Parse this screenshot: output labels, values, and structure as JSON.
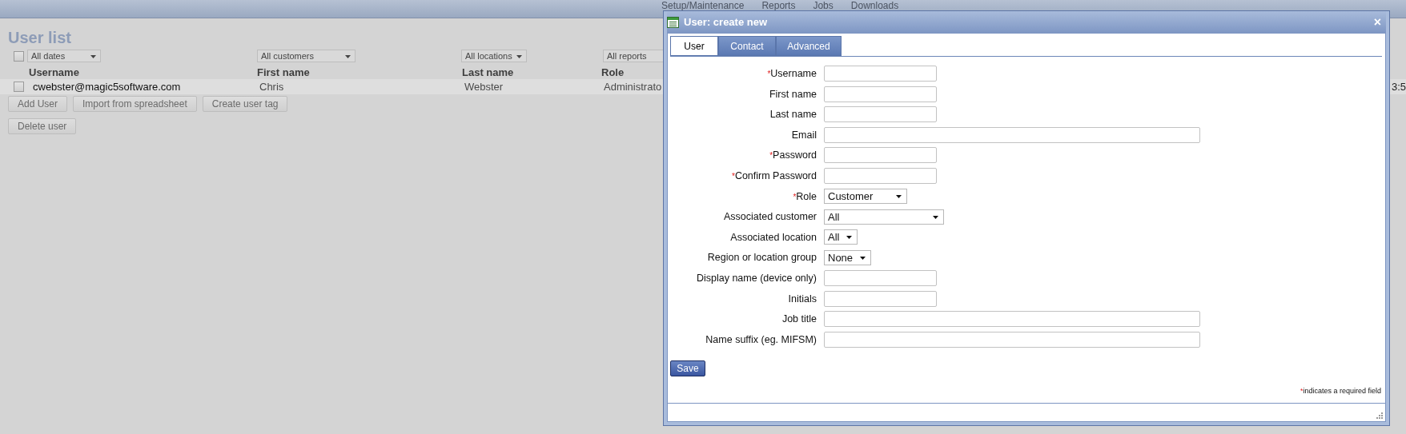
{
  "nav": [
    "Setup/Maintenance",
    "Reports",
    "Jobs",
    "Downloads"
  ],
  "page": {
    "title": "User list",
    "select_all": {
      "checked": false
    },
    "filters": [
      {
        "label": "All dates"
      },
      {
        "label": "All customers"
      },
      {
        "label": "All locations"
      },
      {
        "label": "All reports"
      }
    ],
    "columns": [
      "Username",
      "First name",
      "Last name",
      "Role"
    ],
    "rows": [
      {
        "cells": [
          "cwebster@magic5software.com",
          "Chris",
          "Webster",
          "Administrato"
        ],
        "trailing": "3:5",
        "checked": false
      }
    ],
    "buttons": [
      [
        "Add User",
        "Import from spreadsheet",
        "Create user tag"
      ],
      [
        "Delete user"
      ]
    ]
  },
  "dialog": {
    "title": "User: create new",
    "close": "×",
    "tabs": [
      {
        "label": "User",
        "selected": true
      },
      {
        "label": "Contact",
        "selected": false
      },
      {
        "label": "Advanced",
        "selected": false
      }
    ],
    "fields": [
      {
        "label": "Username",
        "required": true,
        "kind": "short"
      },
      {
        "label": "First name",
        "required": false,
        "kind": "short"
      },
      {
        "label": "Last name",
        "required": false,
        "kind": "short"
      },
      {
        "label": "Email",
        "required": false,
        "kind": "long"
      },
      {
        "label": "Password",
        "required": true,
        "kind": "short"
      },
      {
        "label": "Confirm Password",
        "required": true,
        "kind": "short"
      },
      {
        "label": "Role",
        "required": true,
        "kind": "select",
        "value": "Customer"
      },
      {
        "label": "Associated customer",
        "required": false,
        "kind": "select",
        "value": "All"
      },
      {
        "label": "Associated location",
        "required": false,
        "kind": "select",
        "value": "All"
      },
      {
        "label": "Region or location group",
        "required": false,
        "kind": "select",
        "value": "None"
      },
      {
        "label": "Display name (device only)",
        "required": false,
        "kind": "short"
      },
      {
        "label": "Initials",
        "required": false,
        "kind": "short"
      },
      {
        "label": "Job title",
        "required": false,
        "kind": "long"
      },
      {
        "label": "Name suffix (eg. MIFSM)",
        "required": false,
        "kind": "long"
      }
    ],
    "save": "Save",
    "required_mark": "*",
    "required_note": "indicates a required field"
  }
}
